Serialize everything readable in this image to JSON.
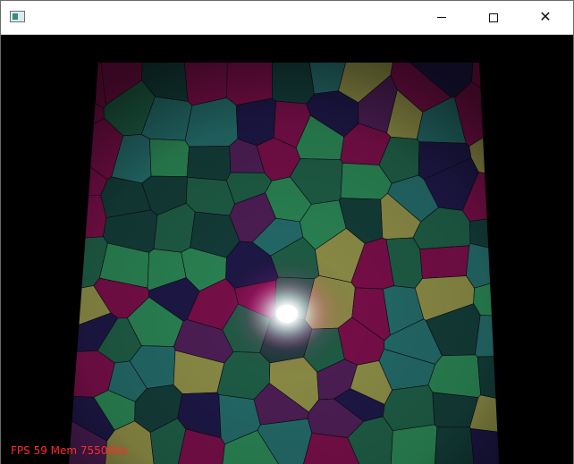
{
  "window": {
    "title": "",
    "icon": "app-window-icon",
    "controls": {
      "minimize_icon": "minimize-icon",
      "maximize_icon": "maximize-icon",
      "close_icon": "close-icon",
      "close_glyph": "✕"
    }
  },
  "scene": {
    "description_colors": {
      "background": "#000000",
      "palette": [
        "#8f8f48",
        "#1f5f47",
        "#7a0f4a",
        "#1e1848",
        "#246c6a",
        "#143e3a",
        "#4f1f57",
        "#2b8655"
      ],
      "glow": "#ffffff",
      "glow_tint": "#ff2fae"
    }
  },
  "status": {
    "fps_text": "FPS 59 Mem 75508kb"
  }
}
